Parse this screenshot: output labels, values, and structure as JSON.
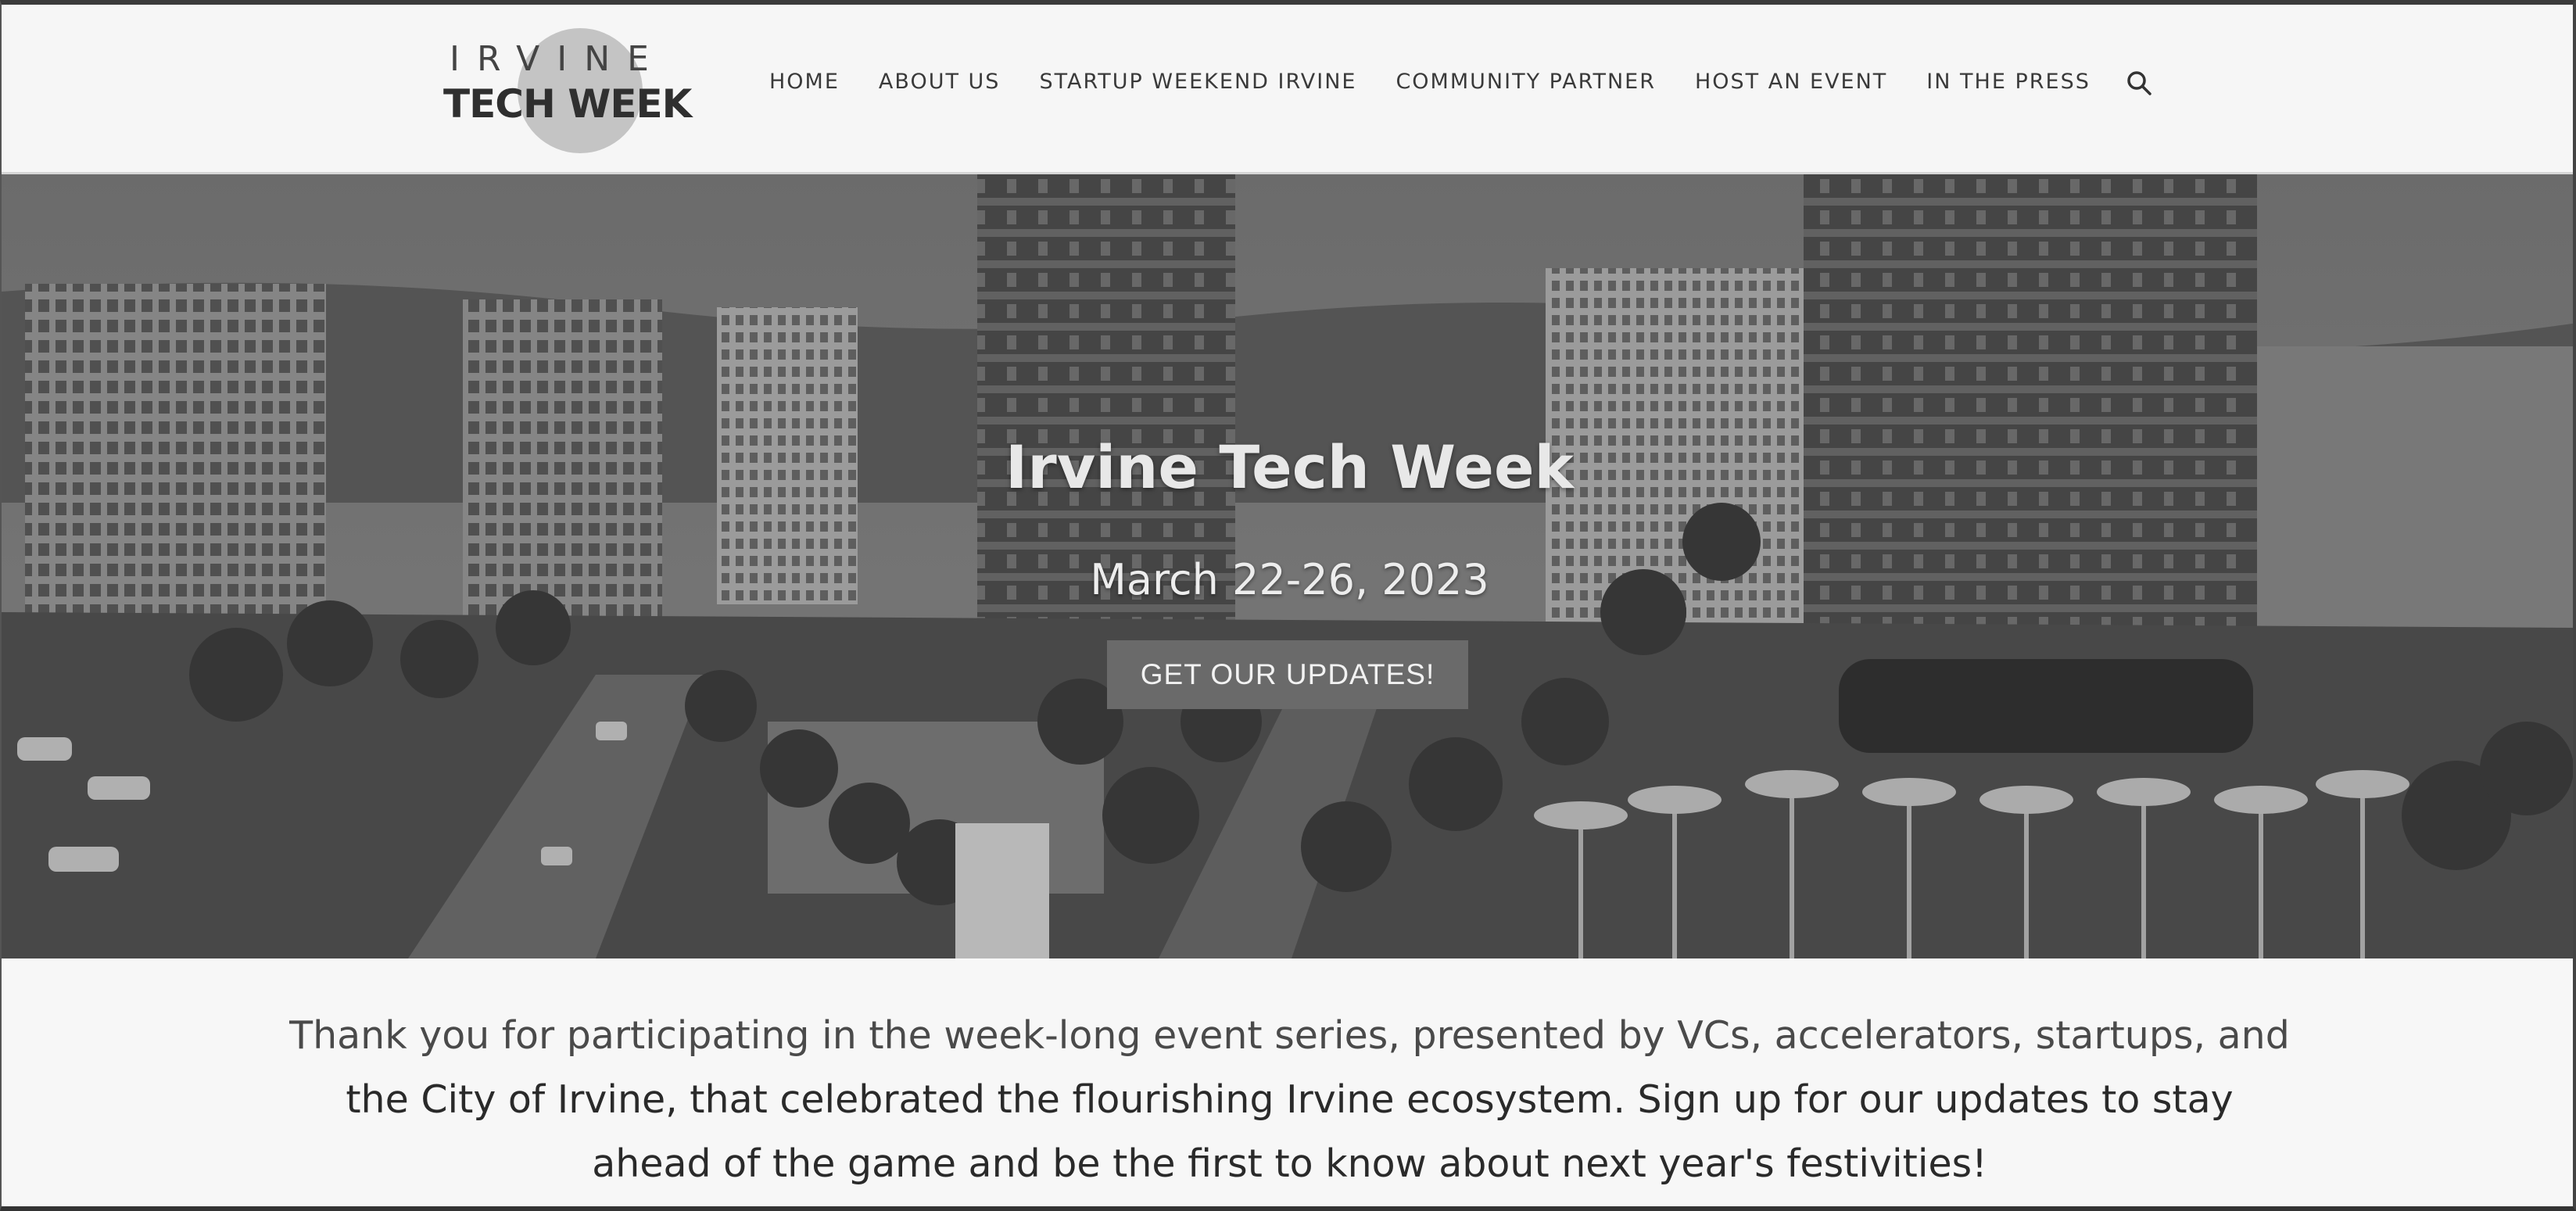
{
  "logo": {
    "line1": "IRVINE",
    "line2": "TECH WEEK"
  },
  "nav": {
    "items": [
      {
        "label": "HOME"
      },
      {
        "label": "ABOUT US"
      },
      {
        "label": "STARTUP WEEKEND IRVINE"
      },
      {
        "label": "COMMUNITY PARTNER"
      },
      {
        "label": "HOST AN EVENT"
      },
      {
        "label": "IN THE PRESS"
      }
    ],
    "search_icon": "search-icon"
  },
  "hero": {
    "title": "Irvine Tech Week",
    "date": "March 22-26, 2023",
    "cta_label": "GET OUR UPDATES!",
    "image": "city-skyline-photo"
  },
  "intro": {
    "line1": "Thank you for participating in the week-long event series, presented by VCs, accelerators, startups, and",
    "line2": "the City of Irvine, that celebrated the flourishing Irvine ecosystem. Sign up for our updates to stay",
    "line3": "ahead of the game and be the first to know about next year's festivities!"
  },
  "colors": {
    "background": "#f7f7f7",
    "cta_background": "#6a6a6a",
    "text": "#2a2a2a"
  }
}
